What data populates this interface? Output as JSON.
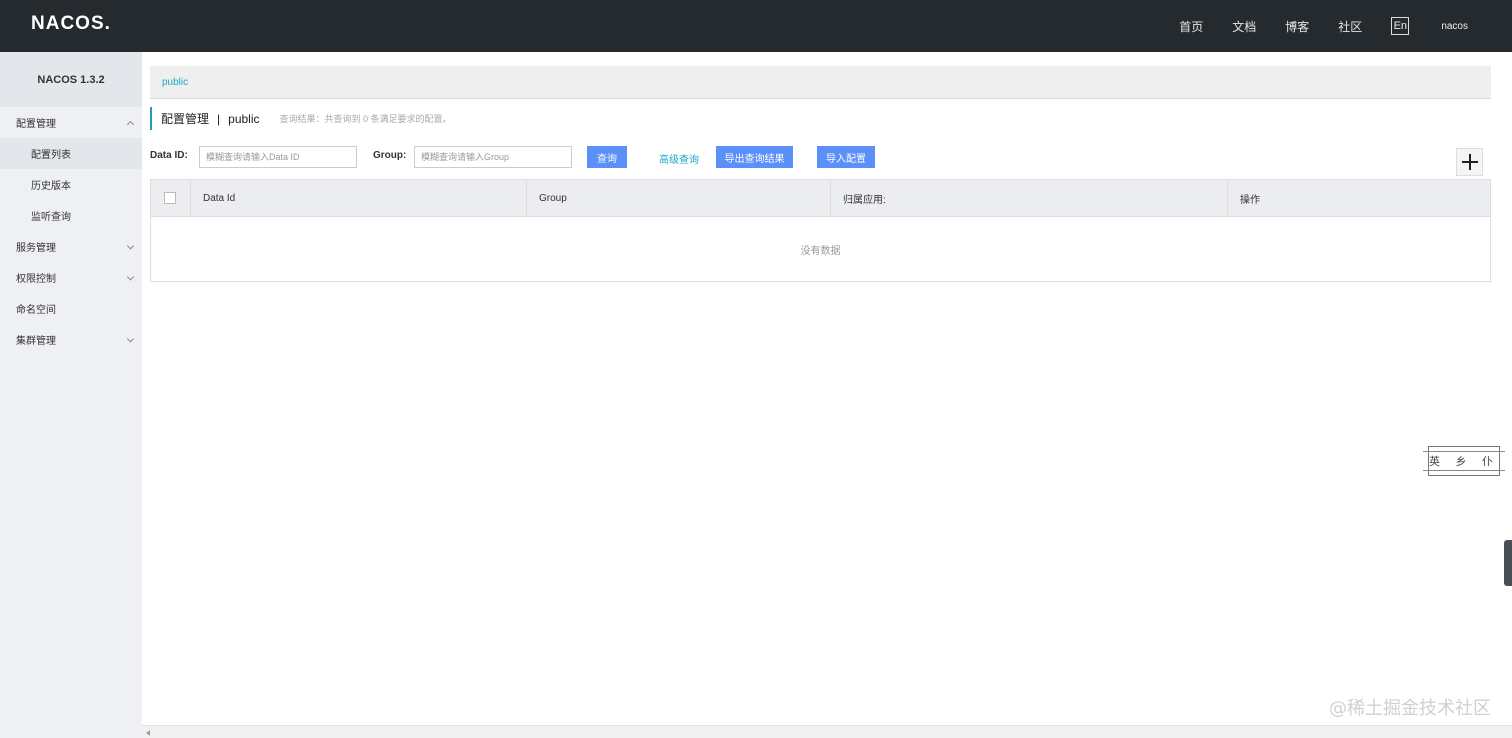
{
  "header": {
    "logo": "NACOS.",
    "nav": [
      "首页",
      "文档",
      "博客",
      "社区"
    ],
    "lang": "En",
    "user": "nacos"
  },
  "sidebar": {
    "version": "NACOS 1.3.2",
    "groups": [
      {
        "label": "配置管理",
        "expanded": true,
        "items": [
          "配置列表",
          "历史版本",
          "监听查询"
        ],
        "active_item": "配置列表"
      },
      {
        "label": "服务管理",
        "expanded": false
      },
      {
        "label": "权限控制",
        "expanded": false
      },
      {
        "label": "命名空间"
      },
      {
        "label": "集群管理",
        "expanded": false
      }
    ]
  },
  "namespace_bar": {
    "current": "public"
  },
  "page": {
    "title": "配置管理",
    "separator": "|",
    "namespace": "public",
    "result_text": "查询结果：共查询到 0 条满足要求的配置。"
  },
  "filters": {
    "data_id_label": "Data ID:",
    "data_id_placeholder": "模糊查询请输入Data ID",
    "data_id_value": "",
    "group_label": "Group:",
    "group_placeholder": "模糊查询请输入Group",
    "group_value": "",
    "search_button": "查询",
    "advanced_link": "高级查询",
    "export_button": "导出查询结果",
    "import_button": "导入配置"
  },
  "table": {
    "columns": [
      "Data Id",
      "Group",
      "归属应用:",
      "操作"
    ],
    "rows": [],
    "empty_text": "没有数据"
  },
  "decor": {
    "stamp": "英 乡 仆",
    "watermark": "@稀土掘金技术社区"
  },
  "colors": {
    "header_bg": "#252a2f",
    "sidebar_bg": "#eef0f3",
    "primary_button": "#5b8ff9",
    "link": "#1fa9c7"
  }
}
